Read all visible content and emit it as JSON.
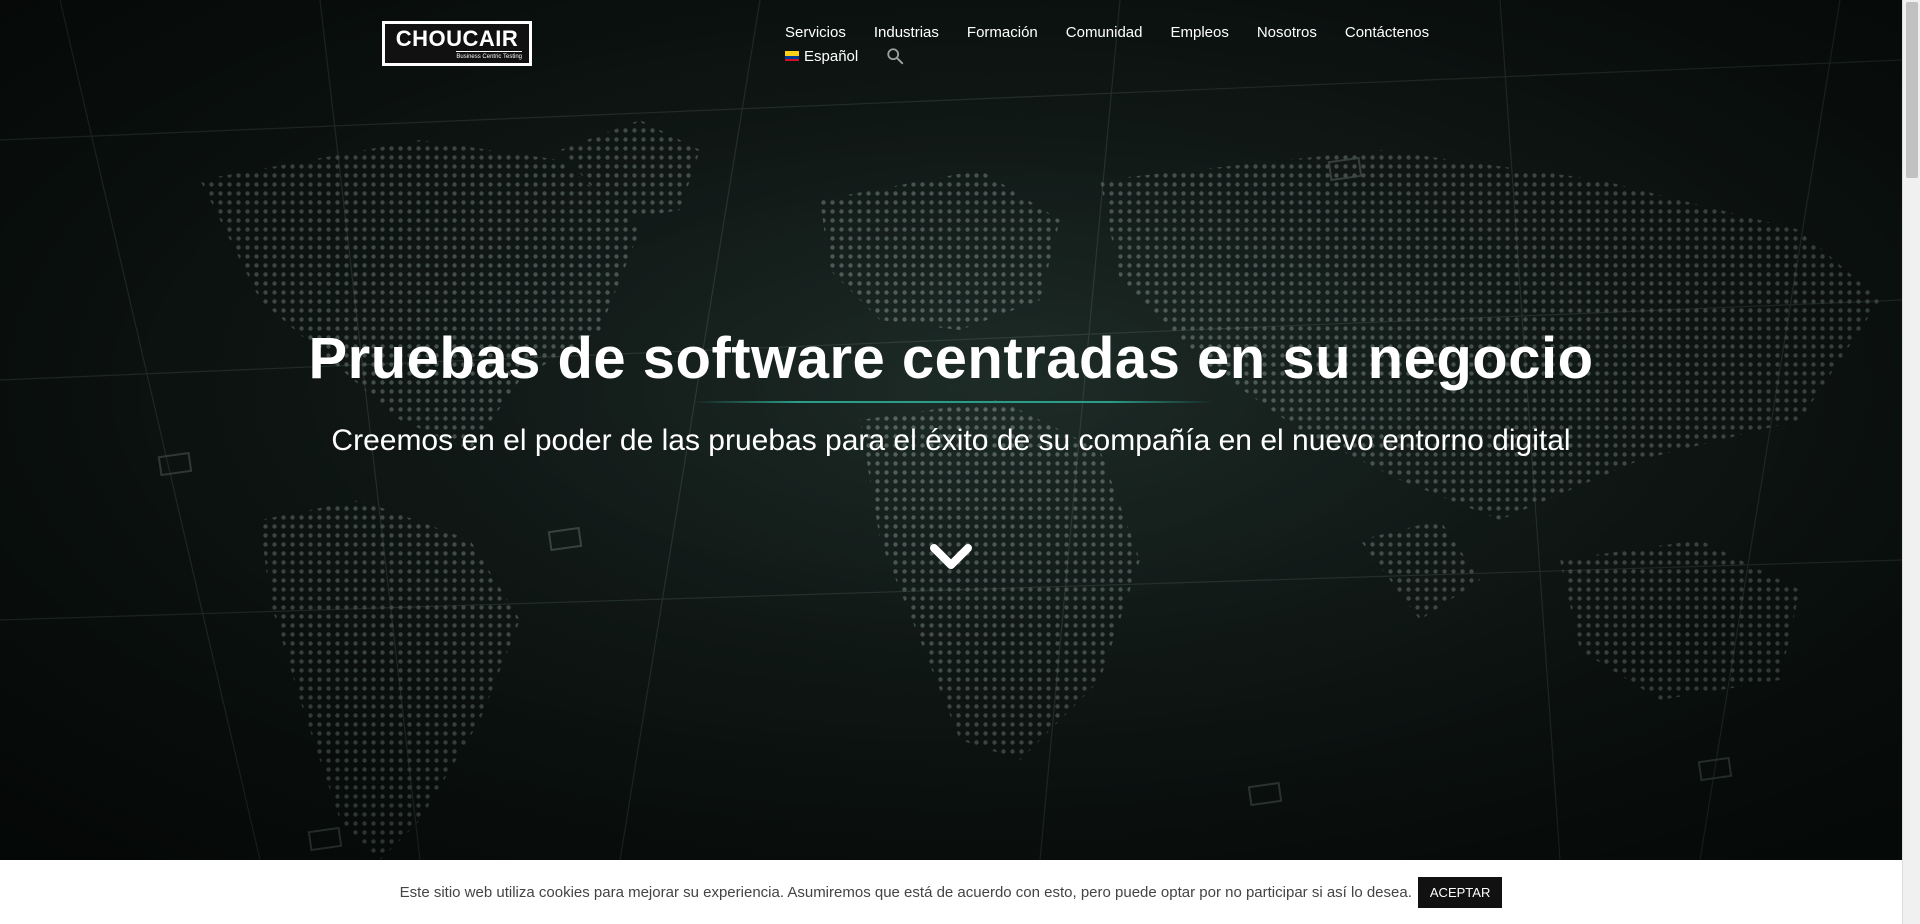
{
  "brand": {
    "name": "CHOUCAIR",
    "tagline": "Business Centric Testing"
  },
  "nav": {
    "items": [
      "Servicios",
      "Industrias",
      "Formación",
      "Comunidad",
      "Empleos",
      "Nosotros",
      "Contáctenos"
    ],
    "language": "Español",
    "search_icon": "search-icon"
  },
  "hero": {
    "title": "Pruebas de software centradas en su negocio",
    "subtitle": "Creemos en el poder de las pruebas para el éxito de su compañía en el nuevo entorno digital",
    "scroll_icon": "chevron-down-icon"
  },
  "cookie": {
    "text": "Este sitio web utiliza cookies para mejorar su experiencia. Asumiremos que está de acuerdo con esto, pero puede optar por no participar si así lo desea.",
    "accept_label": "ACEPTAR"
  },
  "colors": {
    "accent": "#2a9d8a",
    "background": "#141e1b",
    "text": "#ffffff"
  }
}
